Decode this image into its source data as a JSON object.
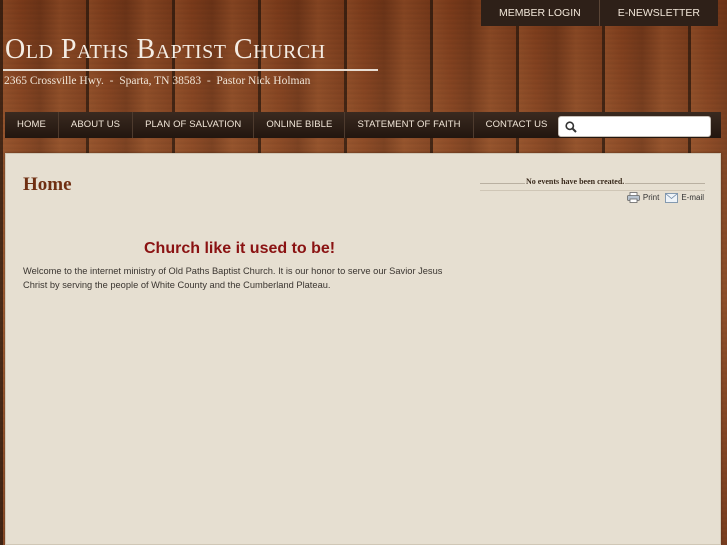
{
  "top_links": [
    {
      "label": "MEMBER LOGIN"
    },
    {
      "label": "E-NEWSLETTER"
    }
  ],
  "site": {
    "title": "Old Paths Baptist Church",
    "subtitle": "2365 Crossville Hwy.  -  Sparta, TN 38583  -  Pastor Nick Holman"
  },
  "nav": [
    {
      "label": "HOME"
    },
    {
      "label": "ABOUT US"
    },
    {
      "label": "PLAN OF SALVATION"
    },
    {
      "label": "ONLINE BIBLE"
    },
    {
      "label": "STATEMENT OF FAITH"
    },
    {
      "label": "CONTACT US"
    }
  ],
  "search": {
    "placeholder": "",
    "icon": "magnifier-icon"
  },
  "page": {
    "title": "Home",
    "headline": "Church like it used to be!",
    "intro": "Welcome to the internet ministry of Old Paths Baptist Church.  It is our honor to serve our Savior Jesus Christ by serving the people of White County and the  Cumberland Plateau."
  },
  "sidebar": {
    "events_text": "No events have been created.",
    "print_label": "Print",
    "email_label": "E-mail"
  },
  "colors": {
    "headline": "#8a1212",
    "title": "#6f2f12",
    "panel": "#e6dfd1",
    "navbar": "#22160f"
  }
}
